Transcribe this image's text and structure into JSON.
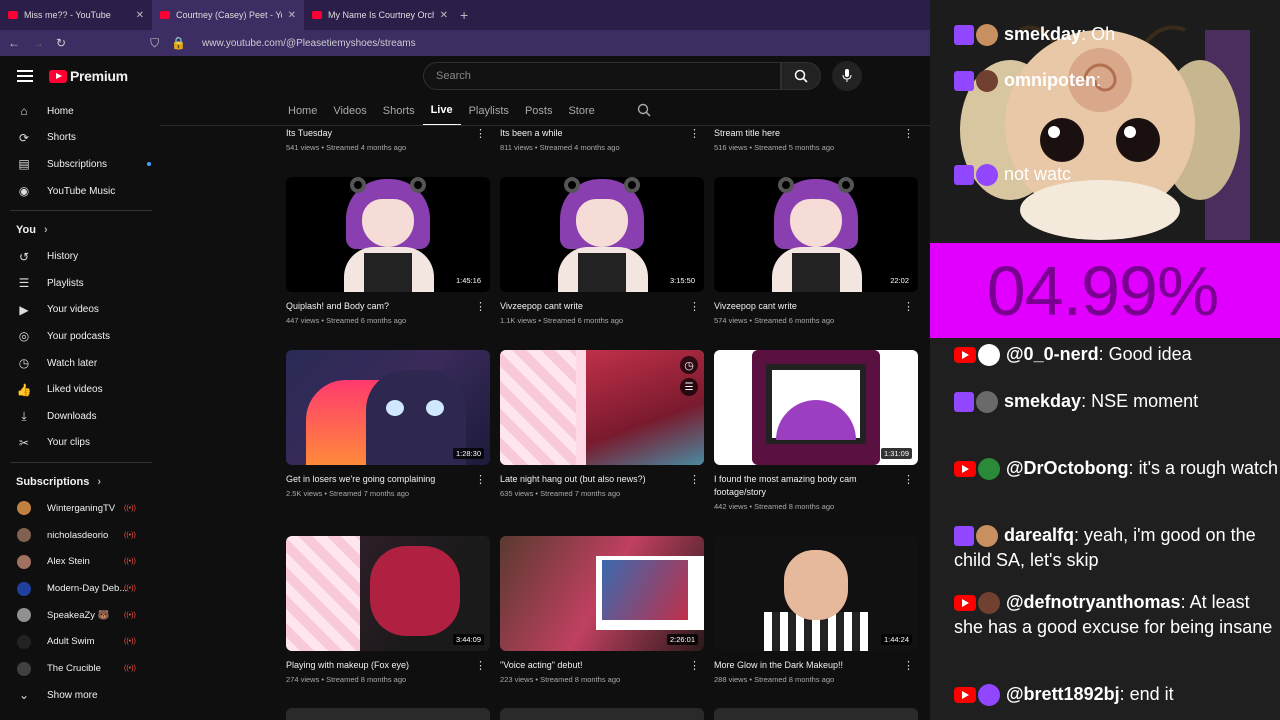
{
  "browser": {
    "tabs": [
      {
        "title": "Miss me?? - YouTube",
        "active": false
      },
      {
        "title": "Courtney (Casey) Peet - YouTub",
        "active": true
      },
      {
        "title": "My Name Is Courtney Orch",
        "active": false
      }
    ],
    "url": "www.youtube.com/@Pleasetiemyshoes/streams"
  },
  "header": {
    "logo_text": "Premium",
    "search_placeholder": "Search"
  },
  "sidebar": {
    "main": [
      {
        "label": "Home",
        "icon": "home-icon",
        "glyph": "⌂"
      },
      {
        "label": "Shorts",
        "icon": "shorts-icon",
        "glyph": "⟳"
      },
      {
        "label": "Subscriptions",
        "icon": "subscriptions-icon",
        "glyph": "▤"
      },
      {
        "label": "YouTube Music",
        "icon": "music-icon",
        "glyph": "◉"
      }
    ],
    "you_label": "You",
    "you_items": [
      {
        "label": "History",
        "icon": "history-icon",
        "glyph": "↺"
      },
      {
        "label": "Playlists",
        "icon": "playlists-icon",
        "glyph": "☰"
      },
      {
        "label": "Your videos",
        "icon": "your-videos-icon",
        "glyph": "▶"
      },
      {
        "label": "Your podcasts",
        "icon": "podcasts-icon",
        "glyph": "◎"
      },
      {
        "label": "Watch later",
        "icon": "watch-later-icon",
        "glyph": "◷"
      },
      {
        "label": "Liked videos",
        "icon": "like-icon",
        "glyph": "👍"
      },
      {
        "label": "Downloads",
        "icon": "download-icon",
        "glyph": "⤓"
      },
      {
        "label": "Your clips",
        "icon": "clips-icon",
        "glyph": "✂"
      }
    ],
    "subs_label": "Subscriptions",
    "subscriptions": [
      {
        "name": "WinterganingTV",
        "color": "#c08040"
      },
      {
        "name": "nicholasdeorio",
        "color": "#806050"
      },
      {
        "name": "Alex Stein",
        "color": "#a07060"
      },
      {
        "name": "Modern-Day Deb...",
        "color": "#2040a0"
      },
      {
        "name": "SpeakeaZy 🐻",
        "color": "#909090"
      },
      {
        "name": "Adult Swim",
        "color": "#222222"
      },
      {
        "name": "The Crucible",
        "color": "#404040"
      }
    ],
    "show_more": "Show more"
  },
  "channel_tabs": [
    "Home",
    "Videos",
    "Shorts",
    "Live",
    "Playlists",
    "Posts",
    "Store"
  ],
  "active_tab": "Live",
  "videos": [
    {
      "title": "Its Tuesday",
      "meta": "541 views • Streamed 4 months ago",
      "duration": "",
      "art": "none"
    },
    {
      "title": "Its been a while",
      "meta": "811 views • Streamed 4 months ago",
      "duration": "",
      "art": "none"
    },
    {
      "title": "Stream title here",
      "meta": "516 views • Streamed 5 months ago",
      "duration": "",
      "art": "none"
    },
    {
      "title": "Quiplash! and Body cam?",
      "meta": "447 views • Streamed 6 months ago",
      "duration": "1:45:16",
      "art": "girl"
    },
    {
      "title": "Vivzeepop cant write",
      "meta": "1.1K views • Streamed 6 months ago",
      "duration": "3:15:50",
      "art": "girl"
    },
    {
      "title": "Vivzeepop cant write",
      "meta": "574 views • Streamed 6 months ago",
      "duration": "22:02",
      "art": "girl"
    },
    {
      "title": "Get in losers we're going complaining",
      "meta": "2.5K views • Streamed 7 months ago",
      "duration": "1:28:30",
      "art": "dragon"
    },
    {
      "title": "Late night hang out (but also news?)",
      "meta": "635 views • Streamed 7 months ago",
      "duration": "",
      "art": "pink"
    },
    {
      "title": "I found the most amazing body cam footage/story",
      "meta": "442 views • Streamed 8 months ago",
      "duration": "1:31:09",
      "art": "logo"
    },
    {
      "title": "Playing with makeup (Fox eye)",
      "meta": "274 views • Streamed 8 months ago",
      "duration": "3:44:09",
      "art": "cam1"
    },
    {
      "title": "\"Voice acting\" debut!",
      "meta": "223 views • Streamed 8 months ago",
      "duration": "2:26:01",
      "art": "cam2"
    },
    {
      "title": "More Glow in the Dark Makeup!!",
      "meta": "288 views • Streamed 8 months ago",
      "duration": "1:44:24",
      "art": "cam3"
    }
  ],
  "overlay": {
    "percent": "04.99%",
    "chat": [
      {
        "platform": "twitch",
        "user": "smekday",
        "text": "Oh"
      },
      {
        "platform": "twitch",
        "user": "omnipoten",
        "text": ""
      },
      {
        "platform": "twitch",
        "user": "",
        "text": "not watc"
      },
      {
        "platform": "youtube",
        "user": "@0_0-nerd",
        "text": "Good idea"
      },
      {
        "platform": "twitch",
        "user": "smekday",
        "text": "NSE moment"
      },
      {
        "platform": "youtube",
        "user": "@DrOctobong",
        "text": "it's a rough watch"
      },
      {
        "platform": "twitch",
        "user": "darealfq",
        "text": "yeah, i'm good on the child SA, let's skip"
      },
      {
        "platform": "youtube",
        "user": "@defnotryanthomas",
        "text": "At least she has a good excuse for being insane"
      },
      {
        "platform": "youtube",
        "user": "@brett1892bj",
        "text": "end it"
      }
    ]
  }
}
